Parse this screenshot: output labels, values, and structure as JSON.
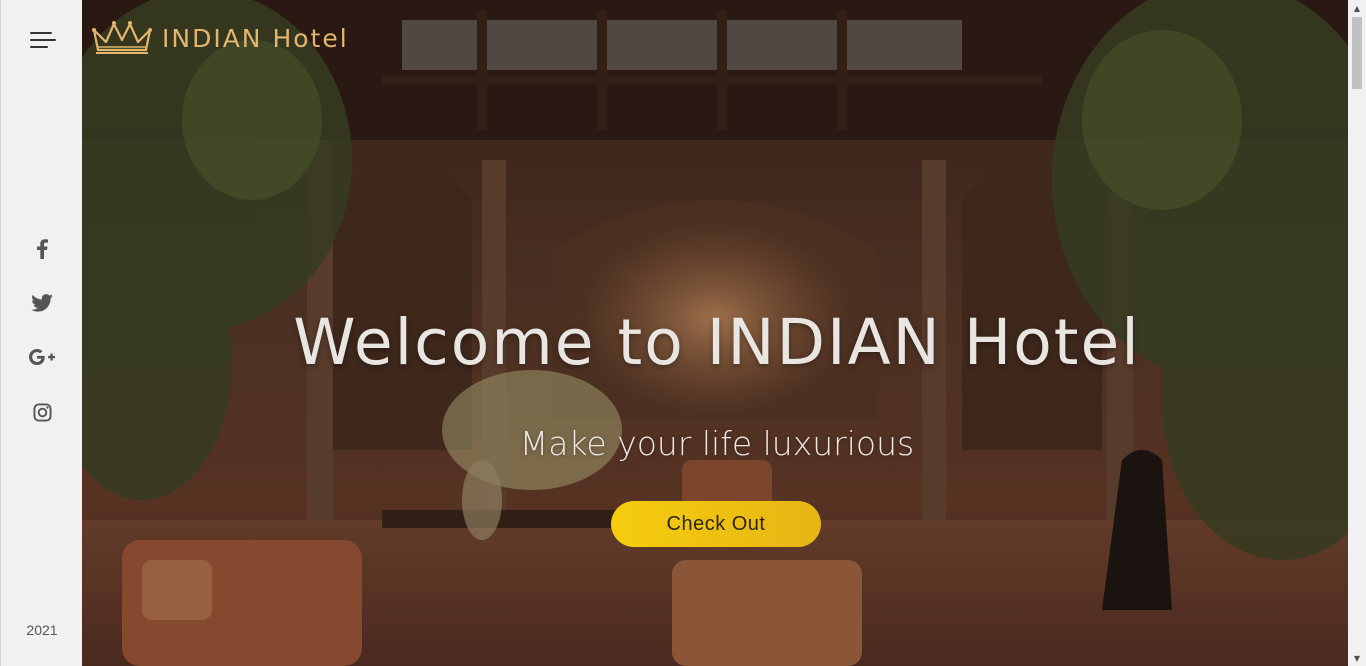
{
  "brand": {
    "name": "INDIAN Hotel",
    "logo_icon": "crown-icon",
    "color": "#e3b66e"
  },
  "sidebar": {
    "menu_icon": "hamburger-menu-icon",
    "social": [
      {
        "name": "facebook-icon"
      },
      {
        "name": "twitter-icon"
      },
      {
        "name": "google-plus-icon"
      },
      {
        "name": "instagram-icon"
      }
    ],
    "year": "2021"
  },
  "hero": {
    "headline": "Welcome to INDIAN Hotel",
    "subheadline": "Make your life luxurious",
    "cta_label": "Check Out",
    "cta_color": "#f6cd0e"
  },
  "scrollbar": {
    "up_arrow": "▲",
    "down_arrow": "▼"
  }
}
